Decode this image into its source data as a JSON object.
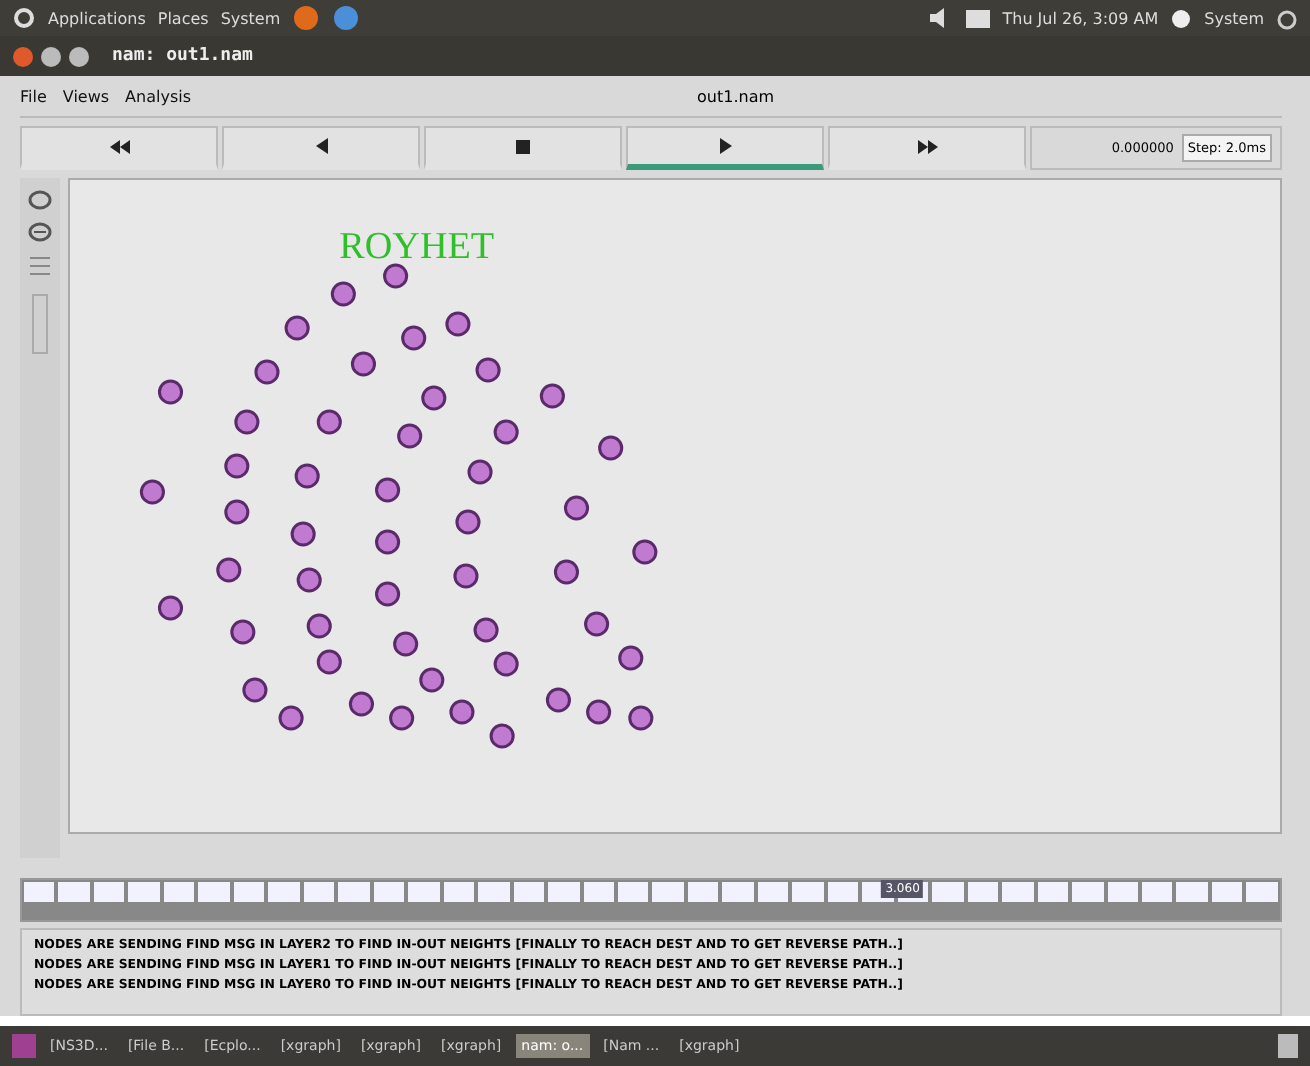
{
  "top_panel": {
    "menus": [
      "Applications",
      "Places",
      "System"
    ],
    "clock": "Thu Jul 26, 3:09 AM",
    "user": "System"
  },
  "window": {
    "title": "nam: out1.nam"
  },
  "menu": [
    "File",
    "Views",
    "Analysis"
  ],
  "file_label": "out1.nam",
  "controls": [
    {
      "kind": "rewind",
      "selected": false
    },
    {
      "kind": "back",
      "selected": false
    },
    {
      "kind": "stop",
      "selected": false
    },
    {
      "kind": "play",
      "selected": true
    },
    {
      "kind": "forward",
      "selected": false
    }
  ],
  "time": "0.000000",
  "step": "Step: 2.0ms",
  "canvas": {
    "annotation": "ROYHET"
  },
  "timeline": {
    "level": 0.7,
    "thumb": "3.060"
  },
  "log": [
    "NODES ARE SENDING FIND MSG IN LAYER2 TO FIND IN-OUT NEIGHTS [FINALLY TO REACH DEST AND TO GET REVERSE PATH..]",
    "NODES ARE SENDING FIND MSG IN LAYER1 TO FIND IN-OUT NEIGHTS [FINALLY TO REACH DEST AND TO GET REVERSE PATH..]",
    "NODES ARE SENDING FIND MSG IN LAYER0 TO FIND IN-OUT NEIGHTS [FINALLY TO REACH DEST AND TO GET REVERSE PATH..]"
  ],
  "taskbar": [
    {
      "label": "[NS3D...",
      "selected": false
    },
    {
      "label": "[File B...",
      "selected": false
    },
    {
      "label": "[Ecplo...",
      "selected": false
    },
    {
      "label": "[xgraph]",
      "selected": false
    },
    {
      "label": "[xgraph]",
      "selected": false
    },
    {
      "label": "[xgraph]",
      "selected": false
    },
    {
      "label": "nam: o...",
      "selected": true
    },
    {
      "label": "[Nam ...",
      "selected": false
    },
    {
      "label": "[xgraph]",
      "selected": false
    }
  ]
}
